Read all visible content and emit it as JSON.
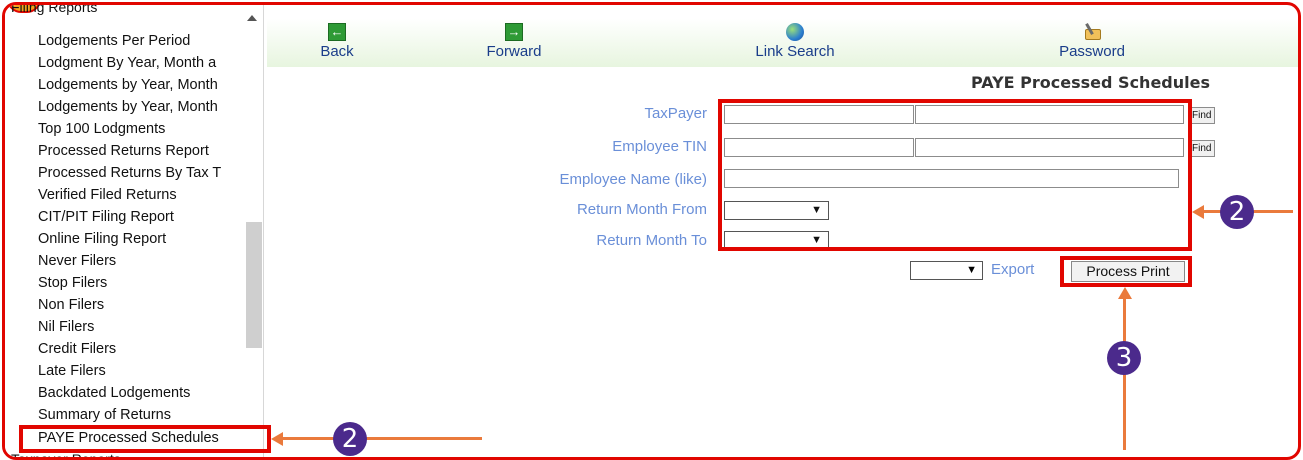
{
  "sidebar": {
    "section_header": "Filing Reports",
    "items": [
      {
        "label": "Lodgements Per Period"
      },
      {
        "label": "Lodgment By Year, Month a"
      },
      {
        "label": "Lodgements by Year, Month"
      },
      {
        "label": "Lodgements by Year, Month"
      },
      {
        "label": "Top 100 Lodgments"
      },
      {
        "label": "Processed Returns Report"
      },
      {
        "label": "Processed Returns By Tax T"
      },
      {
        "label": "Verified Filed Returns"
      },
      {
        "label": "CIT/PIT Filing Report"
      },
      {
        "label": "Online Filing Report"
      },
      {
        "label": "Never Filers"
      },
      {
        "label": "Stop Filers"
      },
      {
        "label": "Non Filers"
      },
      {
        "label": "Nil Filers"
      },
      {
        "label": "Credit Filers"
      },
      {
        "label": "Late Filers"
      },
      {
        "label": "Backdated Lodgements"
      },
      {
        "label": "Summary of Returns"
      },
      {
        "label": "PAYE Processed Schedules"
      }
    ],
    "next_section": "Taxpayer Reports"
  },
  "toolbar": {
    "back": "Back",
    "forward": "Forward",
    "link_search": "Link Search",
    "password": "Password"
  },
  "page": {
    "title": "PAYE Processed Schedules"
  },
  "form": {
    "taxpayer_label": "TaxPayer",
    "employee_tin_label": "Employee TIN",
    "employee_name_label": "Employee Name (like)",
    "return_month_from_label": "Return Month From",
    "return_month_to_label": "Return Month To",
    "find_label": "Find",
    "export_label": "Export",
    "process_print_label": "Process Print",
    "taxpayer_code": "",
    "taxpayer_name": "",
    "employee_tin_code": "",
    "employee_tin_name": "",
    "employee_name": "",
    "month_from": "",
    "month_to": "",
    "export_format": ""
  },
  "annotations": {
    "step_sidebar": "2",
    "step_form": "2",
    "step_print": "3",
    "highlight_color": "#e10600",
    "arrow_color": "#ea7a3c",
    "badge_color": "#4b2a8c"
  }
}
